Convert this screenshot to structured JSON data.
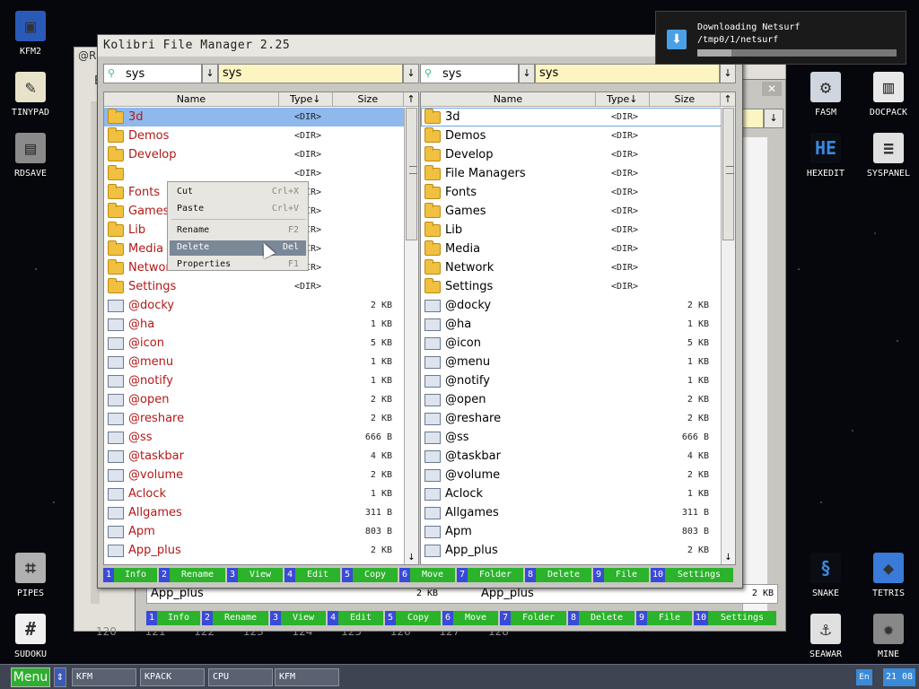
{
  "desktop_icons_left": [
    {
      "label": "KFM2",
      "color": "#2a5ab8",
      "glyph": "▣"
    },
    {
      "label": "TINYPAD",
      "color": "#e8e2c8",
      "glyph": "✎"
    },
    {
      "label": "RDSAVE",
      "color": "#8a8a8a",
      "glyph": "▤"
    },
    {
      "label": "PIPES",
      "color": "#b0b0b0",
      "glyph": "⌗"
    },
    {
      "label": "SUDOKU",
      "color": "#f0f0f0",
      "glyph": "#"
    }
  ],
  "desktop_icons_right": [
    {
      "label": "FASM",
      "color": "#cfd6e0",
      "glyph": "⚙"
    },
    {
      "label": "DOCPACK",
      "color": "#e8e8e8",
      "glyph": "▥"
    },
    {
      "label": "HEXEDIT",
      "color": "#0b0d14",
      "glyph": "HE"
    },
    {
      "label": "SYSPANEL",
      "color": "#e0e0e0",
      "glyph": "≡"
    },
    {
      "label": "SNAKE",
      "color": "#0b0d14",
      "glyph": "§"
    },
    {
      "label": "TETRIS",
      "color": "#3a7ad8",
      "glyph": "◆"
    },
    {
      "label": "SEAWAR",
      "color": "#e0e0e0",
      "glyph": "⚓"
    },
    {
      "label": "MINE",
      "color": "#888888",
      "glyph": "✹"
    }
  ],
  "background_window": {
    "title": "@RE",
    "row_text": "Ea",
    "tick_labels": [
      "120",
      "121",
      "122",
      "123",
      "124",
      "125",
      "126",
      "127",
      "128"
    ]
  },
  "notification": {
    "line1": "Downloading Netsurf",
    "line2": "/tmp0/1/netsurf",
    "progress": 0.17
  },
  "window": {
    "title": "Kolibri File Manager 2.25"
  },
  "left_panel": {
    "drive": "sys",
    "path": "sys",
    "columns": {
      "name": "Name",
      "type": "Type↓",
      "size": "Size",
      "up": "↑"
    },
    "rows": [
      {
        "name": "3d",
        "type": "<DIR>",
        "size": "",
        "kind": "folder",
        "selected": true
      },
      {
        "name": "Demos",
        "type": "<DIR>",
        "size": "",
        "kind": "folder"
      },
      {
        "name": "Develop",
        "type": "<DIR>",
        "size": "",
        "kind": "folder"
      },
      {
        "name": "",
        "type": "<DIR>",
        "size": "",
        "kind": "folder"
      },
      {
        "name": "Fonts",
        "type": "<DIR>",
        "size": "",
        "kind": "folder"
      },
      {
        "name": "Games",
        "type": "<DIR>",
        "size": "",
        "kind": "folder"
      },
      {
        "name": "Lib",
        "type": "<DIR>",
        "size": "",
        "kind": "folder"
      },
      {
        "name": "Media",
        "type": "<DIR>",
        "size": "",
        "kind": "folder"
      },
      {
        "name": "Network",
        "type": "<DIR>",
        "size": "",
        "kind": "folder"
      },
      {
        "name": "Settings",
        "type": "<DIR>",
        "size": "",
        "kind": "folder"
      },
      {
        "name": "@docky",
        "type": "",
        "size": "2 KB",
        "kind": "file"
      },
      {
        "name": "@ha",
        "type": "",
        "size": "1 KB",
        "kind": "file"
      },
      {
        "name": "@icon",
        "type": "",
        "size": "5 KB",
        "kind": "file"
      },
      {
        "name": "@menu",
        "type": "",
        "size": "1 KB",
        "kind": "file"
      },
      {
        "name": "@notify",
        "type": "",
        "size": "1 KB",
        "kind": "file"
      },
      {
        "name": "@open",
        "type": "",
        "size": "2 KB",
        "kind": "file"
      },
      {
        "name": "@reshare",
        "type": "",
        "size": "2 KB",
        "kind": "file"
      },
      {
        "name": "@ss",
        "type": "",
        "size": "666 B",
        "kind": "file"
      },
      {
        "name": "@taskbar",
        "type": "",
        "size": "4 KB",
        "kind": "file"
      },
      {
        "name": "@volume",
        "type": "",
        "size": "2 KB",
        "kind": "file"
      },
      {
        "name": "Aclock",
        "type": "",
        "size": "1 KB",
        "kind": "file"
      },
      {
        "name": "Allgames",
        "type": "",
        "size": "311 B",
        "kind": "file"
      },
      {
        "name": "Apm",
        "type": "",
        "size": "803 B",
        "kind": "file"
      },
      {
        "name": "App_plus",
        "type": "",
        "size": "2 KB",
        "kind": "file"
      }
    ]
  },
  "right_panel": {
    "drive": "sys",
    "path": "sys",
    "columns": {
      "name": "Name",
      "type": "Type↓",
      "size": "Size",
      "up": "↑"
    },
    "rows": [
      {
        "name": "3d",
        "type": "<DIR>",
        "size": "",
        "kind": "folder",
        "outlined": true
      },
      {
        "name": "Demos",
        "type": "<DIR>",
        "size": "",
        "kind": "folder"
      },
      {
        "name": "Develop",
        "type": "<DIR>",
        "size": "",
        "kind": "folder"
      },
      {
        "name": "File Managers",
        "type": "<DIR>",
        "size": "",
        "kind": "folder"
      },
      {
        "name": "Fonts",
        "type": "<DIR>",
        "size": "",
        "kind": "folder"
      },
      {
        "name": "Games",
        "type": "<DIR>",
        "size": "",
        "kind": "folder"
      },
      {
        "name": "Lib",
        "type": "<DIR>",
        "size": "",
        "kind": "folder"
      },
      {
        "name": "Media",
        "type": "<DIR>",
        "size": "",
        "kind": "folder"
      },
      {
        "name": "Network",
        "type": "<DIR>",
        "size": "",
        "kind": "folder"
      },
      {
        "name": "Settings",
        "type": "<DIR>",
        "size": "",
        "kind": "folder"
      },
      {
        "name": "@docky",
        "type": "",
        "size": "2 KB",
        "kind": "file"
      },
      {
        "name": "@ha",
        "type": "",
        "size": "1 KB",
        "kind": "file"
      },
      {
        "name": "@icon",
        "type": "",
        "size": "5 KB",
        "kind": "file"
      },
      {
        "name": "@menu",
        "type": "",
        "size": "1 KB",
        "kind": "file"
      },
      {
        "name": "@notify",
        "type": "",
        "size": "1 KB",
        "kind": "file"
      },
      {
        "name": "@open",
        "type": "",
        "size": "2 KB",
        "kind": "file"
      },
      {
        "name": "@reshare",
        "type": "",
        "size": "2 KB",
        "kind": "file"
      },
      {
        "name": "@ss",
        "type": "",
        "size": "666 B",
        "kind": "file"
      },
      {
        "name": "@taskbar",
        "type": "",
        "size": "4 KB",
        "kind": "file"
      },
      {
        "name": "@volume",
        "type": "",
        "size": "2 KB",
        "kind": "file"
      },
      {
        "name": "Aclock",
        "type": "",
        "size": "1 KB",
        "kind": "file"
      },
      {
        "name": "Allgames",
        "type": "",
        "size": "311 B",
        "kind": "file"
      },
      {
        "name": "Apm",
        "type": "",
        "size": "803 B",
        "kind": "file"
      },
      {
        "name": "App_plus",
        "type": "",
        "size": "2 KB",
        "kind": "file"
      }
    ]
  },
  "context_menu": {
    "items": [
      {
        "label": "Cut",
        "shortcut": "Crl+X"
      },
      {
        "label": "Paste",
        "shortcut": "Crl+V"
      },
      {
        "label": "Rename",
        "shortcut": "F2"
      },
      {
        "label": "Delete",
        "shortcut": "Del",
        "highlighted": true
      },
      {
        "label": "Properties",
        "shortcut": "F1"
      }
    ]
  },
  "fkeys": [
    {
      "num": "1",
      "label": "Info"
    },
    {
      "num": "2",
      "label": "Rename"
    },
    {
      "num": "3",
      "label": "View"
    },
    {
      "num": "4",
      "label": "Edit"
    },
    {
      "num": "5",
      "label": "Copy"
    },
    {
      "num": "6",
      "label": "Move"
    },
    {
      "num": "7",
      "label": "Folder"
    },
    {
      "num": "8",
      "label": "Delete"
    },
    {
      "num": "9",
      "label": "File"
    },
    {
      "num": "10",
      "label": "Settings"
    }
  ],
  "second_kfm": {
    "close_label": "✕",
    "bottom_left_name": "App_plus",
    "bottom_left_size": "2 KB",
    "bottom_right_name": "App_plus",
    "bottom_right_size": "2 KB"
  },
  "taskbar": {
    "menu_label": "Menu",
    "arrow_label": "⇕",
    "tasks": [
      "KFM",
      "KPACK",
      "CPU",
      "KFM"
    ],
    "lang": "En",
    "clock": "21 08"
  }
}
